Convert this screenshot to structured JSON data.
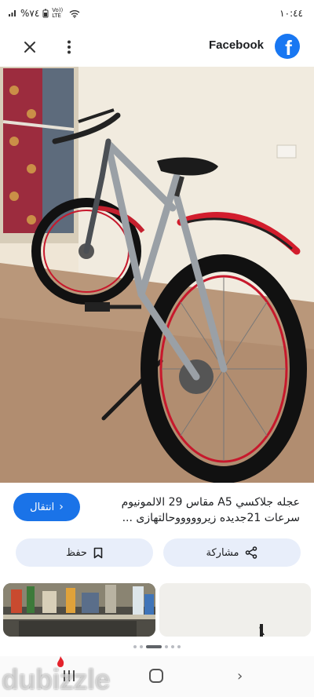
{
  "status_bar": {
    "battery": "%٧٤",
    "network": "Vo)) LTE",
    "time": "١٠:٤٤"
  },
  "header": {
    "close_icon": "close-icon",
    "more_icon": "more-vertical-icon",
    "title": "Facebook",
    "logo_letter": "f",
    "brand_color": "#1877f2"
  },
  "photo": {
    "lens_icon": "visual-search-icon"
  },
  "listing": {
    "title_line1": "عجله جلاكسي A5 مقاس 29 الالمونيوم",
    "title_line2": "سرعات 21جديده زيروووووحالتهازى ...",
    "go_button": "انتقال",
    "save_button": "حفظ",
    "share_button": "مشاركة",
    "accent_color": "#1a73e8",
    "pill_color": "#e8eefa"
  },
  "carousel": {
    "page_count": 6,
    "active_index": 2
  },
  "watermark": "dubizzle"
}
